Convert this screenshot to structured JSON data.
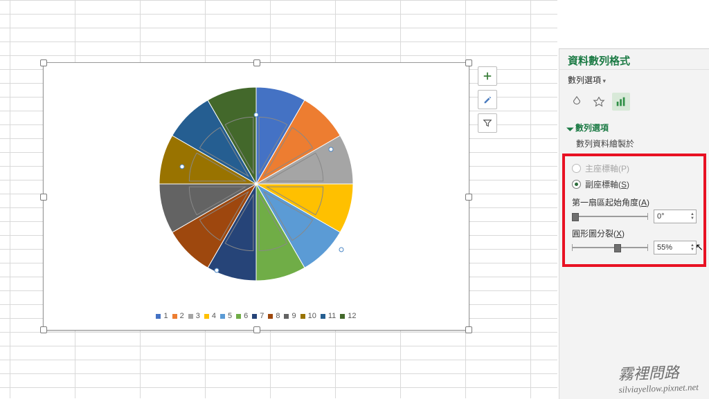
{
  "pane": {
    "title": "資料數列格式",
    "dropdown_label": "數列選項",
    "section_header": "數列選項",
    "plot_on_label": "數列資料繪製於",
    "primary_axis_label": "主座標軸(P)",
    "secondary_axis_label": "副座標軸(S)",
    "angle_label": "第一扇區起始角度(A)",
    "angle_value": "0°",
    "explode_label": "圓形圖分裂(X)",
    "explode_value": "55%"
  },
  "side_buttons": {
    "add": "+",
    "brush": "brush",
    "filter": "filter"
  },
  "watermark": {
    "line1": "霧裡問路",
    "line2": "silviayellow.pixnet.net"
  },
  "chart_data": {
    "type": "pie",
    "title": "",
    "categories": [
      "1",
      "2",
      "3",
      "4",
      "5",
      "6",
      "7",
      "8",
      "9",
      "10",
      "11",
      "12"
    ],
    "values": [
      8.33,
      8.33,
      8.33,
      8.33,
      8.33,
      8.33,
      8.33,
      8.33,
      8.33,
      8.33,
      8.33,
      8.33
    ],
    "series": [
      {
        "name": "1",
        "color": "#4472c4"
      },
      {
        "name": "2",
        "color": "#ed7d31"
      },
      {
        "name": "3",
        "color": "#a5a5a5"
      },
      {
        "name": "4",
        "color": "#ffc000"
      },
      {
        "name": "5",
        "color": "#5b9bd5"
      },
      {
        "name": "6",
        "color": "#70ad47"
      },
      {
        "name": "7",
        "color": "#264478"
      },
      {
        "name": "8",
        "color": "#9e480e"
      },
      {
        "name": "9",
        "color": "#636363"
      },
      {
        "name": "10",
        "color": "#997300"
      },
      {
        "name": "11",
        "color": "#255e91"
      },
      {
        "name": "12",
        "color": "#43682b"
      }
    ],
    "start_angle_deg": 0,
    "explosion_pct": 55,
    "secondary_axis": true
  }
}
